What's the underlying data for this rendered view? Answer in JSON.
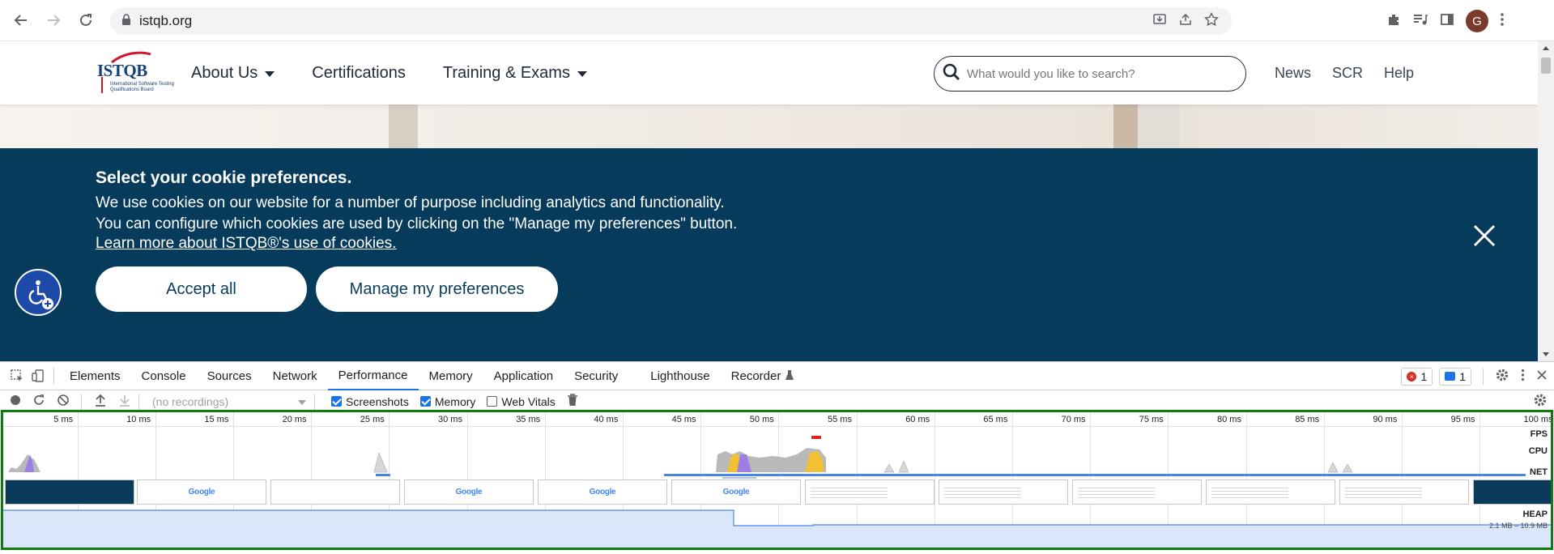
{
  "browser": {
    "url": "istqb.org",
    "profile_initial": "G"
  },
  "site": {
    "logo_text": "ISTQB",
    "logo_sub": "International Software Testing Qualifications Board",
    "nav": [
      {
        "label": "About Us",
        "has_dropdown": true
      },
      {
        "label": "Certifications",
        "has_dropdown": false
      },
      {
        "label": "Training & Exams",
        "has_dropdown": true
      }
    ],
    "search_placeholder": "What would you like to search?",
    "right_nav": [
      "News",
      "SCR",
      "Help"
    ]
  },
  "cookie": {
    "title": "Select your cookie preferences.",
    "line1": "We use cookies on our website for a number of purpose including analytics and functionality.",
    "line2": "You can configure which cookies are used by clicking on the \"Manage my preferences\" button.",
    "learn_more": "Learn more about ISTQB®'s use of cookies.",
    "accept_label": "Accept all",
    "manage_label": "Manage my preferences"
  },
  "colors": {
    "cookie_bg": "#073b5c",
    "tab_active": "#1a73e8",
    "timeline_border": "#0a7d0a",
    "cpu_scripting": "#f2c033",
    "cpu_rendering": "#9b7fe6",
    "cpu_other": "#b9b9b9",
    "net": "#4a86e8"
  },
  "devtools": {
    "tabs": [
      "Elements",
      "Console",
      "Sources",
      "Network",
      "Performance",
      "Memory",
      "Application",
      "Security",
      "Lighthouse",
      "Recorder"
    ],
    "active_tab": "Performance",
    "error_count": "1",
    "message_count": "1",
    "recordings_placeholder": "(no recordings)",
    "checkboxes": [
      {
        "label": "Screenshots",
        "checked": true
      },
      {
        "label": "Memory",
        "checked": true
      },
      {
        "label": "Web Vitals",
        "checked": false
      }
    ],
    "ticks": [
      "5 ms",
      "10 ms",
      "15 ms",
      "20 ms",
      "25 ms",
      "30 ms",
      "35 ms",
      "40 ms",
      "45 ms",
      "50 ms",
      "55 ms",
      "60 ms",
      "65 ms",
      "70 ms",
      "75 ms",
      "80 ms",
      "85 ms",
      "90 ms",
      "95 ms",
      "100 ms"
    ],
    "track_labels": {
      "fps": "FPS",
      "cpu": "CPU",
      "net": "NET",
      "heap": "HEAP"
    },
    "heap_range": "2.1 MB – 10.9 MB"
  }
}
